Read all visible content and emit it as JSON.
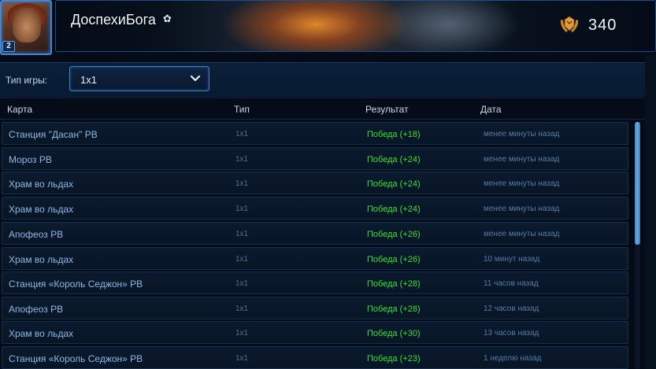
{
  "profile": {
    "name": "ДоспехиБога",
    "level": "2",
    "points": "340"
  },
  "filter": {
    "label": "Тип игры:",
    "selected": "1x1"
  },
  "table": {
    "columns": [
      "Карта",
      "Тип",
      "Результат",
      "Дата"
    ],
    "rows": [
      {
        "map": "Станция \"Дасан\" РВ",
        "type": "1x1",
        "result": "Победа (+18)",
        "date": "менее минуты назад"
      },
      {
        "map": "Мороз РВ",
        "type": "1x1",
        "result": "Победа (+24)",
        "date": "менее минуты назад"
      },
      {
        "map": "Храм во льдах",
        "type": "1x1",
        "result": "Победа (+24)",
        "date": "менее минуты назад"
      },
      {
        "map": "Храм во льдах",
        "type": "1x1",
        "result": "Победа (+24)",
        "date": "менее минуты назад"
      },
      {
        "map": "Апофеоз РВ",
        "type": "1x1",
        "result": "Победа (+26)",
        "date": "менее минуты назад"
      },
      {
        "map": "Храм во льдах",
        "type": "1x1",
        "result": "Победа (+26)",
        "date": "10 минут назад"
      },
      {
        "map": "Станция «Король Седжон» РВ",
        "type": "1x1",
        "result": "Победа (+28)",
        "date": "11 часов назад"
      },
      {
        "map": "Апофеоз РВ",
        "type": "1x1",
        "result": "Победа (+28)",
        "date": "12 часов назад"
      },
      {
        "map": "Храм во льдах",
        "type": "1x1",
        "result": "Победа (+30)",
        "date": "13 часов назад"
      },
      {
        "map": "Станция «Король Седжон» РВ",
        "type": "1x1",
        "result": "Победа (+23)",
        "date": "1 неделю назад"
      }
    ]
  },
  "colors": {
    "accent": "#3f86d8",
    "win": "#3de03a",
    "background": "#040b16"
  },
  "icons": [
    "gear-icon",
    "points-laurel-icon",
    "chevron-down-icon"
  ]
}
